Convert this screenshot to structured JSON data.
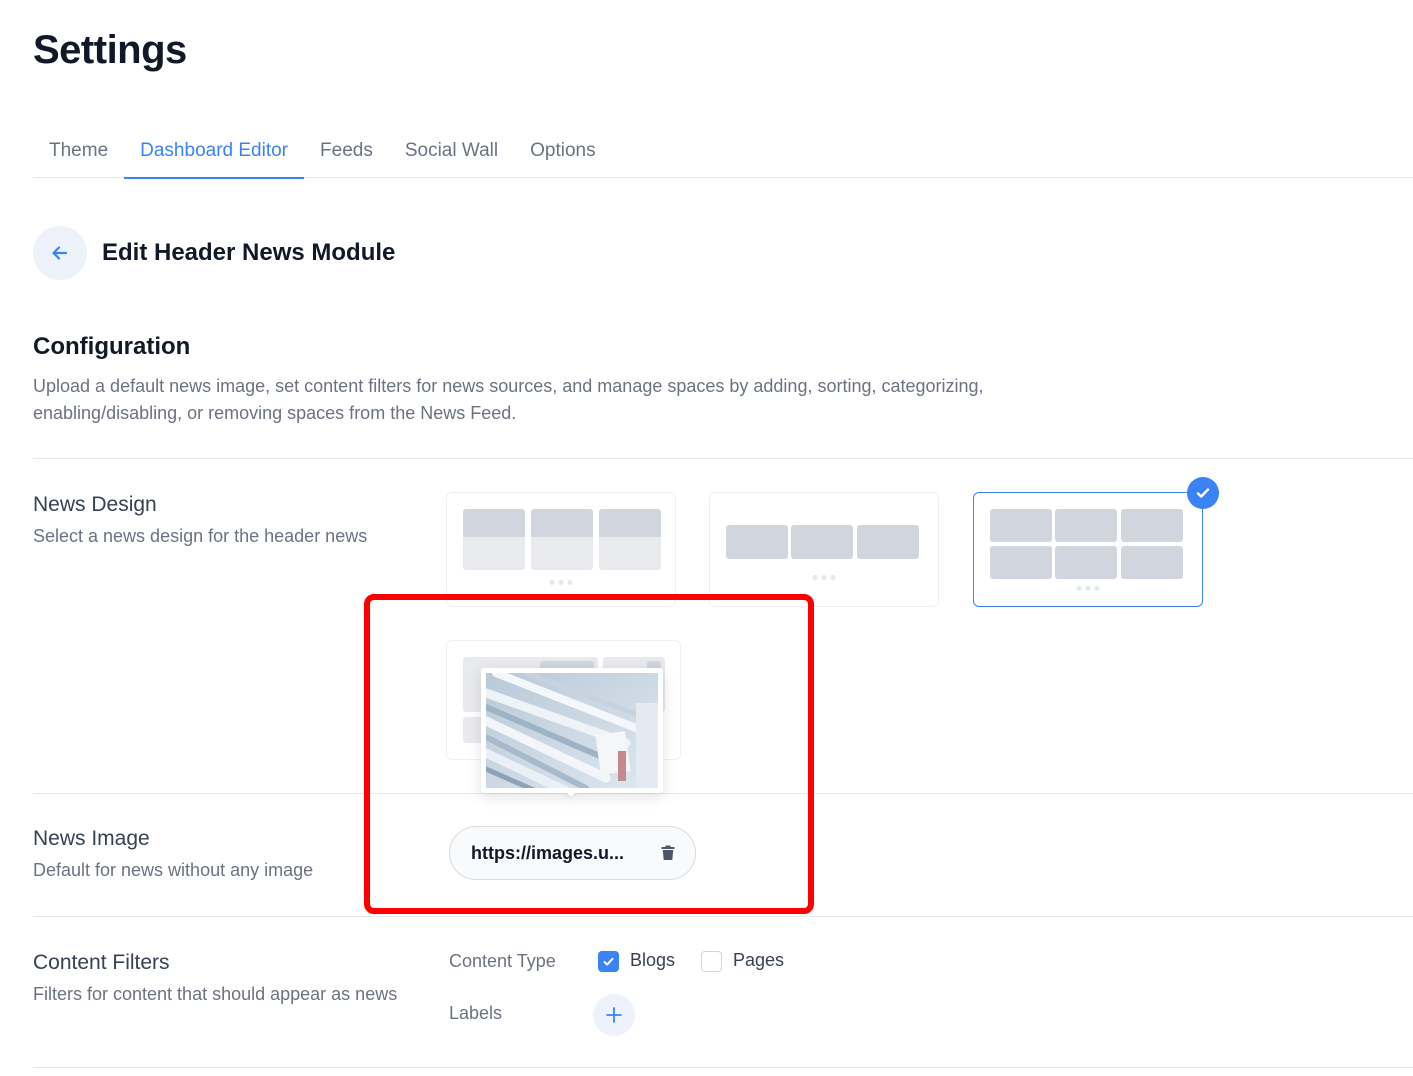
{
  "page": {
    "title": "Settings"
  },
  "tabs": [
    {
      "label": "Theme",
      "active": false
    },
    {
      "label": "Dashboard Editor",
      "active": true
    },
    {
      "label": "Feeds",
      "active": false
    },
    {
      "label": "Social Wall",
      "active": false
    },
    {
      "label": "Options",
      "active": false
    }
  ],
  "editor": {
    "back_icon": "arrow-left-icon",
    "title": "Edit Header News Module"
  },
  "configuration": {
    "title": "Configuration",
    "description": "Upload a default news image, set content filters for news sources, and manage spaces by adding, sorting, categorizing, enabling/disabling, or removing spaces from the News Feed."
  },
  "news_design": {
    "title": "News Design",
    "subtitle": "Select a news design for the header news",
    "options": [
      {
        "name": "cards-with-text",
        "selected": false
      },
      {
        "name": "single-row",
        "selected": false
      },
      {
        "name": "grid-two-rows",
        "selected": true
      },
      {
        "name": "featured-layout",
        "selected": false
      }
    ],
    "selected_icon": "check-icon"
  },
  "news_image": {
    "title": "News Image",
    "subtitle": "Default for news without any image",
    "url_value": "https://images.u...",
    "delete_icon": "trash-icon",
    "preview_alt": "stack of newspapers"
  },
  "content_filters": {
    "title": "Content Filters",
    "subtitle": "Filters for content that should appear as news",
    "content_type_label": "Content Type",
    "options": [
      {
        "label": "Blogs",
        "checked": true
      },
      {
        "label": "Pages",
        "checked": false
      }
    ],
    "labels_label": "Labels",
    "add_icon": "plus-icon"
  },
  "colors": {
    "accent": "#3b82f6",
    "highlight": "#ff0000"
  }
}
